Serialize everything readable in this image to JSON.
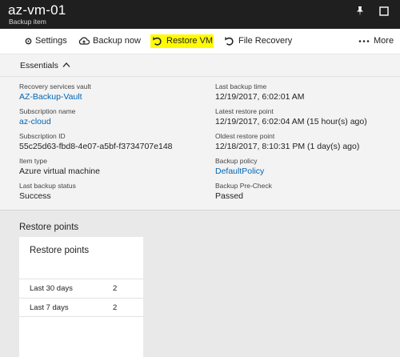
{
  "header": {
    "title": "az-vm-01",
    "subtitle": "Backup item",
    "icons": [
      "pin-icon",
      "maximize-icon"
    ]
  },
  "toolbar": {
    "settings_label": "Settings",
    "backup_now_label": "Backup now",
    "restore_vm_label": "Restore VM",
    "file_recovery_label": "File Recovery",
    "more_label": "More",
    "highlight_color": "#fffb00"
  },
  "essentials": {
    "label": "Essentials",
    "left": [
      {
        "key": "Recovery services vault",
        "value": "AZ-Backup-Vault",
        "link": true
      },
      {
        "key": "Subscription name",
        "value": "az-cloud",
        "link": true
      },
      {
        "key": "Subscription ID",
        "value": "55c25d63-fbd8-4e07-a5bf-f3734707e148",
        "link": false
      },
      {
        "key": "Item type",
        "value": "Azure virtual machine",
        "link": false
      },
      {
        "key": "Last backup status",
        "value": "Success",
        "link": false
      }
    ],
    "right": [
      {
        "key": "Last backup time",
        "value": "12/19/2017, 6:02:01 AM",
        "link": false
      },
      {
        "key": "Latest restore point",
        "value": "12/19/2017, 6:02:04 AM (15 hour(s) ago)",
        "link": false
      },
      {
        "key": "Oldest restore point",
        "value": "12/18/2017, 8:10:31 PM (1 day(s) ago)",
        "link": false
      },
      {
        "key": "Backup policy",
        "value": "DefaultPolicy",
        "link": true
      },
      {
        "key": "Backup Pre-Check",
        "value": "Passed",
        "link": false
      }
    ]
  },
  "restore_points": {
    "section_title": "Restore points",
    "card_title": "Restore points",
    "rows": [
      {
        "label": "Last 30 days",
        "value": "2"
      },
      {
        "label": "Last 7 days",
        "value": "2"
      }
    ]
  },
  "colors": {
    "header_bg": "#1f1f1f",
    "link": "#0065b3",
    "essentials_bg": "#f3f3f3"
  }
}
